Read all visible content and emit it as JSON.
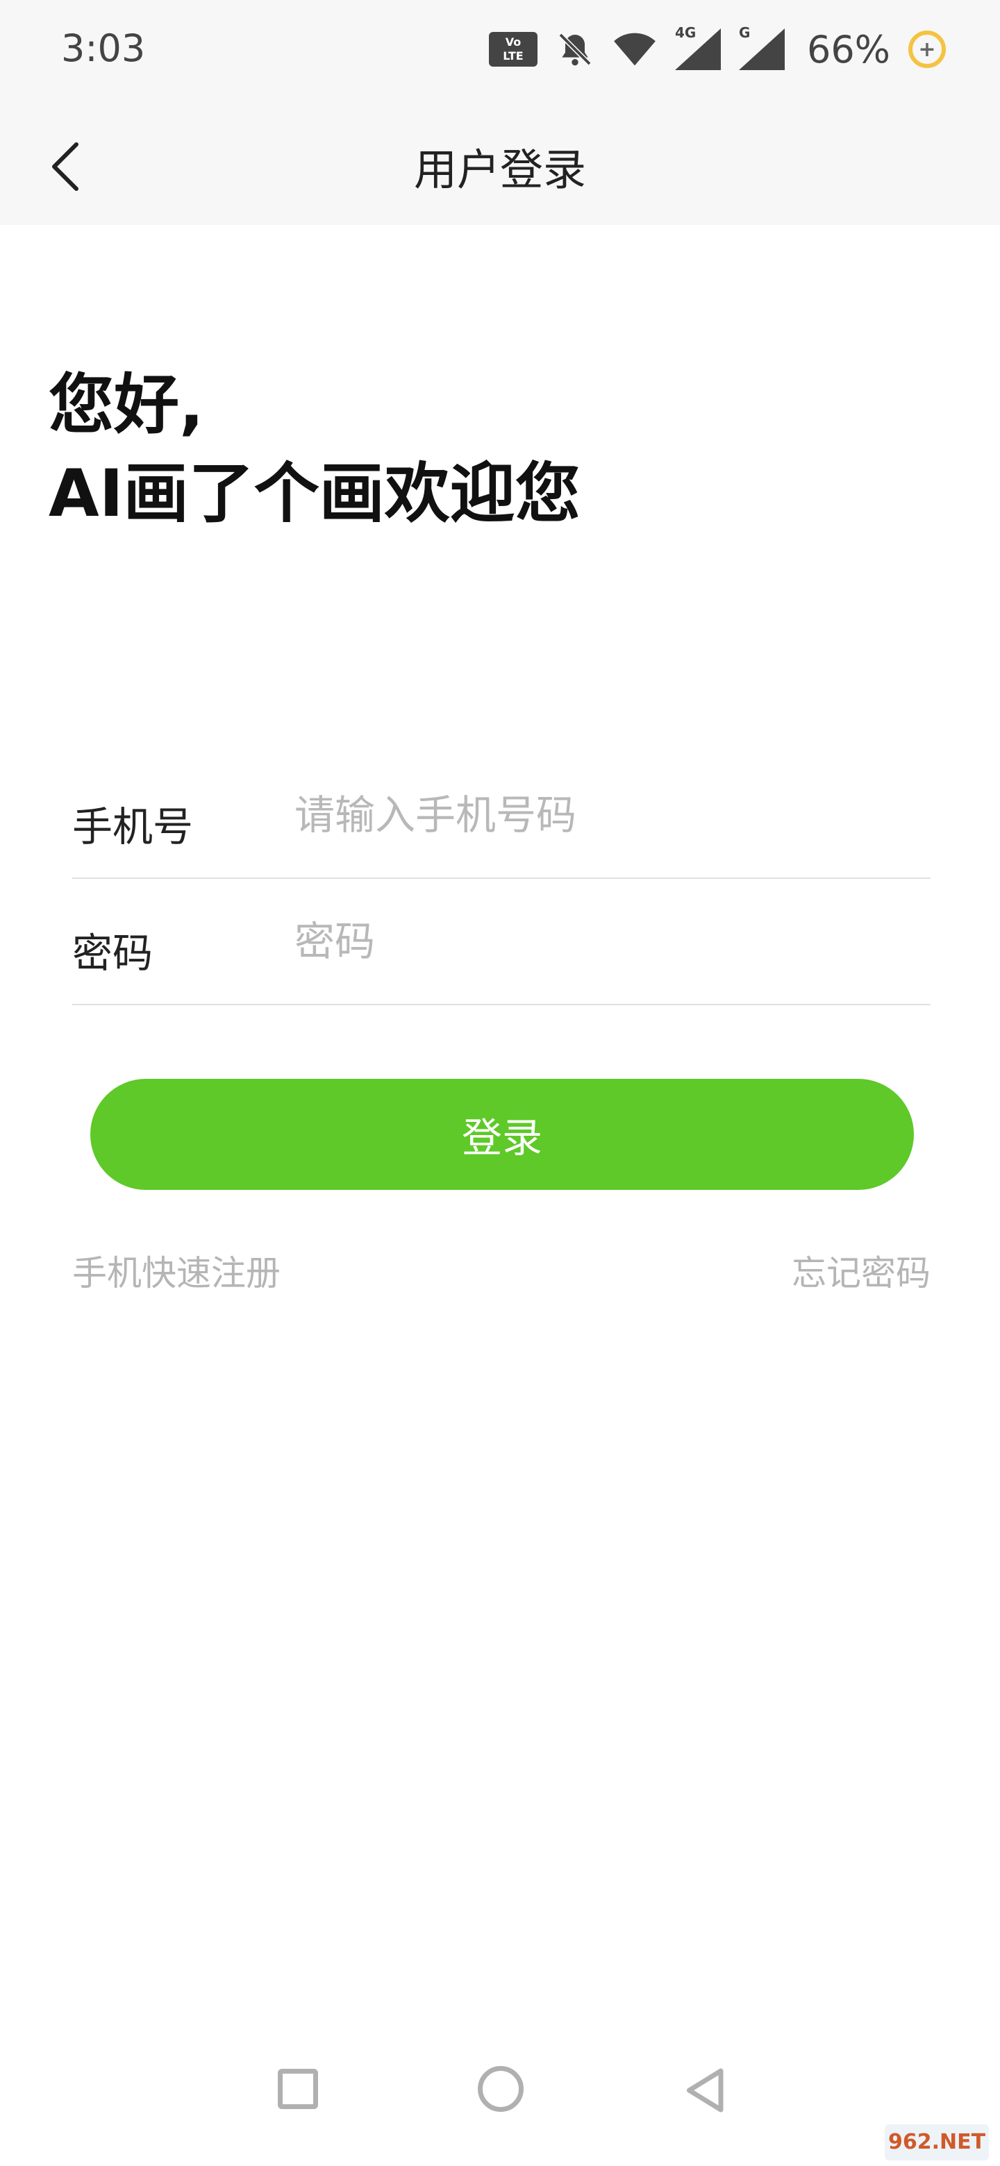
{
  "status_bar": {
    "time": "3:03",
    "volte_top": "Vo",
    "volte_bottom": "LTE",
    "network_4g": "4G",
    "network_g": "G",
    "battery": "66%",
    "icons": [
      "volte-icon",
      "mute-bell-icon",
      "wifi-icon",
      "signal-4g-icon",
      "signal-g-icon",
      "battery-saver-icon"
    ]
  },
  "header": {
    "title": "用户登录",
    "back_icon": "chevron-left-icon"
  },
  "greeting": {
    "line1": "您好,",
    "line2": "AI画了个画欢迎您"
  },
  "form": {
    "phone_label": "手机号",
    "phone_placeholder": "请输入手机号码",
    "phone_value": "",
    "password_label": "密码",
    "password_placeholder": "密码",
    "password_value": ""
  },
  "actions": {
    "login_label": "登录",
    "register_label": "手机快速注册",
    "forgot_label": "忘记密码"
  },
  "colors": {
    "accent": "#5ec928",
    "header_bg": "#f7f7f7",
    "placeholder": "#b8b8b8"
  },
  "watermark": "962.NET"
}
